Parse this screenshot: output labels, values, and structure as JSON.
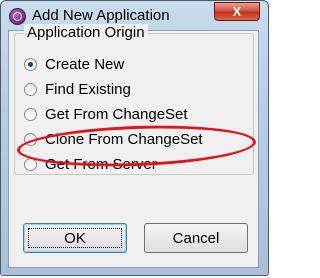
{
  "window": {
    "title": "Add New Application",
    "close_glyph": "X"
  },
  "group": {
    "legend": "Application Origin",
    "options": [
      {
        "label": "Create New",
        "checked": true
      },
      {
        "label": "Find Existing",
        "checked": false
      },
      {
        "label": "Get From ChangeSet",
        "checked": false
      },
      {
        "label": "Clone From ChangeSet",
        "checked": false
      },
      {
        "label": "Get From Server",
        "checked": false
      }
    ]
  },
  "buttons": {
    "ok": "OK",
    "cancel": "Cancel"
  },
  "annotation": {
    "highlight_color": "#e0141e",
    "highlight_target": "Get From ChangeSet"
  }
}
